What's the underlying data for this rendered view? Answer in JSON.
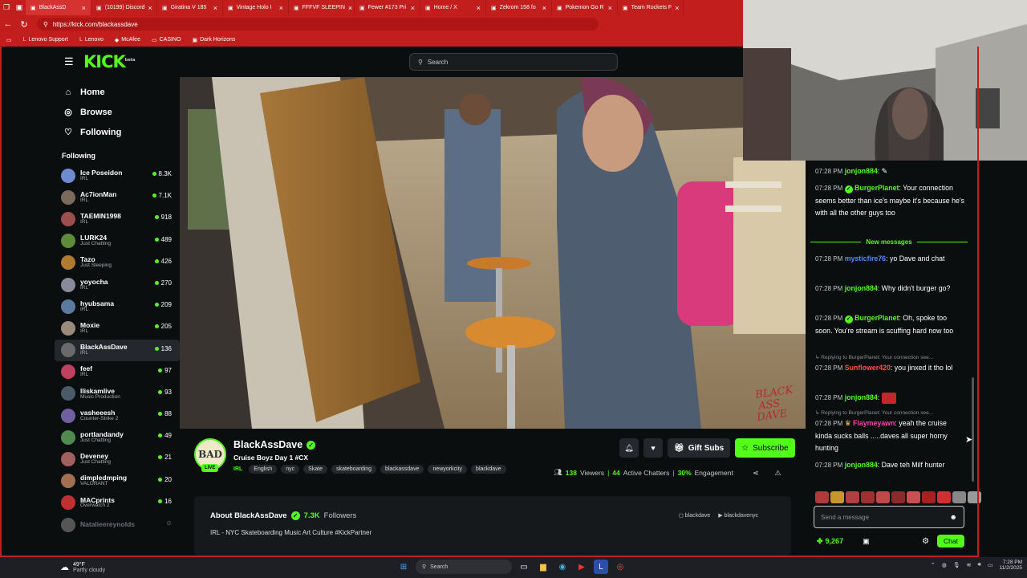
{
  "browser": {
    "tabs": [
      {
        "label": "BlackAssD",
        "active": true
      },
      {
        "label": "(10199) Discord",
        "active": false
      },
      {
        "label": "Giratina V 185",
        "active": false
      },
      {
        "label": "Vintage Holo I",
        "active": false
      },
      {
        "label": "FFFVF SLEEPIN",
        "active": false
      },
      {
        "label": "Fewer #173 Pri",
        "active": false
      },
      {
        "label": "Home / X",
        "active": false
      },
      {
        "label": "Zekrom 158 fo",
        "active": false
      },
      {
        "label": "Pokemon Go R",
        "active": false
      },
      {
        "label": "Team Rockets F",
        "active": false
      }
    ],
    "url": "https://kick.com/blackassdave",
    "bookmarks": [
      "Lenovo Support",
      "Lenovo",
      "McAfee",
      "CASINO",
      "Dark Horizons"
    ]
  },
  "kick": {
    "logo": "KICK",
    "logo_beta": "beta",
    "search_placeholder": "Search",
    "nav": [
      {
        "label": "Home",
        "icon": "home-icon"
      },
      {
        "label": "Browse",
        "icon": "compass-icon"
      },
      {
        "label": "Following",
        "icon": "heart-icon"
      }
    ],
    "following_label": "Following",
    "channels": [
      {
        "name": "Ice Poseidon",
        "category": "IRL",
        "viewers": "8.3K"
      },
      {
        "name": "Ac7ionMan",
        "category": "IRL",
        "viewers": "7.1K"
      },
      {
        "name": "TAEMIN1998",
        "category": "IRL",
        "viewers": "918"
      },
      {
        "name": "LURK24",
        "category": "Just Chatting",
        "viewers": "489"
      },
      {
        "name": "Tazo",
        "category": "Just Sleeping",
        "viewers": "426"
      },
      {
        "name": "yoyocha",
        "category": "IRL",
        "viewers": "270"
      },
      {
        "name": "hyubsama",
        "category": "IRL",
        "viewers": "209"
      },
      {
        "name": "Moxie",
        "category": "IRL",
        "viewers": "205"
      },
      {
        "name": "BlackAssDave",
        "category": "IRL",
        "viewers": "136",
        "selected": true
      },
      {
        "name": "feef",
        "category": "IRL",
        "viewers": "97"
      },
      {
        "name": "lliskamlive",
        "category": "Music Production",
        "viewers": "93"
      },
      {
        "name": "vasheeesh",
        "category": "Counter-Strike 2",
        "viewers": "88"
      },
      {
        "name": "portlandandy",
        "category": "Just Chatting",
        "viewers": "49"
      },
      {
        "name": "Deveney",
        "category": "Just Chatting",
        "viewers": "21"
      },
      {
        "name": "dimpledmping",
        "category": "VALORANT",
        "viewers": "20"
      },
      {
        "name": "MACprints",
        "category": "Overwatch 2",
        "viewers": "16"
      },
      {
        "name": "Natalieereynolds",
        "category": "",
        "viewers": "",
        "offline": true
      }
    ],
    "stream": {
      "avatar_text": "BAD",
      "live": "LIVE",
      "streamer": "BlackAssDave",
      "title": "Cruise Boyz Day 1 #CX",
      "category": "IRL",
      "tags": [
        "English",
        "nyc",
        "Skate",
        "skateboarding",
        "blackassdave",
        "newyorkcity",
        "blackdave"
      ],
      "gift_label": "Gift Subs",
      "subscribe_label": "Subscribe",
      "viewers": "138",
      "viewers_label": "Viewers",
      "chatters": "44",
      "chatters_label": "Active Chatters",
      "engagement": "30%",
      "engagement_label": "Engagement",
      "watermark": "BLACK ASS DAVE"
    },
    "about": {
      "title": "About BlackAssDave",
      "followers": "7.3K",
      "followers_label": "Followers",
      "description": "IRL - NYC Skateboarding Music Art Culture #KickPartner",
      "social1": "blackdave",
      "social2": "blackdavenyc"
    },
    "chat": {
      "messages": [
        {
          "time": "07:28 PM",
          "user": "jonjon884",
          "color": "#53fc18",
          "text": "",
          "emote": "bug"
        },
        {
          "time": "07:28 PM",
          "user": "BurgerPlanet",
          "color": "#53fc18",
          "badge": true,
          "text": "Your connection seems better than ice's maybe it's because he's with all the other guys too"
        },
        {
          "time": "07:28 PM",
          "user": "mysticfire76",
          "color": "#4f8bff",
          "text": "yo Dave and chat"
        },
        {
          "time": "07:28 PM",
          "user": "jonjon884",
          "color": "#53fc18",
          "text": "Why didn't burger go?"
        },
        {
          "time": "07:28 PM",
          "user": "BurgerPlanet",
          "color": "#53fc18",
          "badge": true,
          "text": "Oh, spoke too soon. You're stream is scuffing hard now too"
        },
        {
          "time": "07:28 PM",
          "user": "Sunflower420",
          "color": "#ff4b4b",
          "text": "you jinxed it tho lol",
          "reply": "Replying to BurgerPlanet: Your connection see..."
        },
        {
          "time": "07:28 PM",
          "user": "jonjon884",
          "color": "#53fc18",
          "text": "",
          "emote": "red"
        },
        {
          "time": "07:28 PM",
          "user": "Flaymeyawn",
          "color": "#ff3fb0",
          "text": "yeah the cruise kinda sucks balls .....daves all super horny hunting",
          "reply": "Replying to BurgerPlanet: Your connection see..."
        },
        {
          "time": "07:28 PM",
          "user": "jonjon884",
          "color": "#53fc18",
          "text": "Dave teh Milf hunter"
        }
      ],
      "new_messages": "New messages",
      "input_placeholder": "Send a message",
      "points": "9,267",
      "chat_button": "Chat"
    }
  },
  "taskbar": {
    "temp": "49°F",
    "weather": "Partly cloudy",
    "search": "Search",
    "time": "7:28 PM",
    "date": "11/2/2025"
  },
  "colors": {
    "kick_green": "#53fc18",
    "browser_red": "#c21e1e",
    "bg": "#0b0e0f"
  }
}
